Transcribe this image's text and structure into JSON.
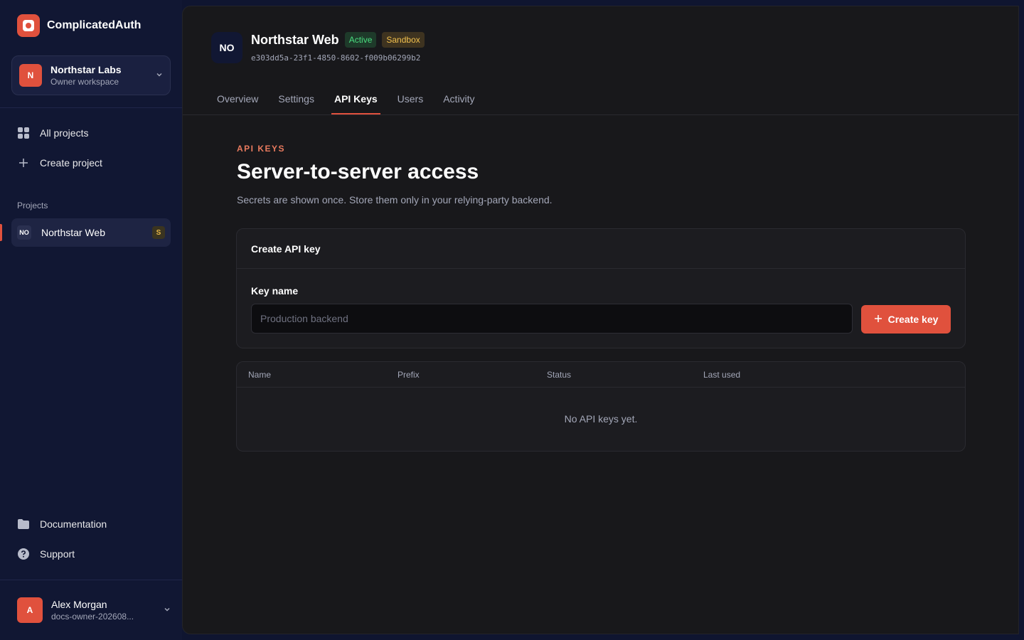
{
  "brand": {
    "name": "ComplicatedAuth"
  },
  "workspace": {
    "initial": "N",
    "name": "Northstar Labs",
    "role": "Owner workspace"
  },
  "nav": {
    "all_projects": "All projects",
    "create_project": "Create project",
    "projects_label": "Projects",
    "project": {
      "badge": "NO",
      "name": "Northstar Web",
      "env": "S"
    },
    "documentation": "Documentation",
    "support": "Support"
  },
  "user": {
    "initial": "A",
    "name": "Alex Morgan",
    "email": "docs-owner-202608..."
  },
  "header": {
    "avatar": "NO",
    "title": "Northstar Web",
    "status_badge": "Active",
    "env_badge": "Sandbox",
    "id": "e303dd5a-23f1-4850-8602-f009b06299b2"
  },
  "tabs": [
    "Overview",
    "Settings",
    "API Keys",
    "Users",
    "Activity"
  ],
  "page": {
    "eyebrow": "API KEYS",
    "heading": "Server-to-server access",
    "subtext": "Secrets are shown once. Store them only in your relying-party backend."
  },
  "create_card": {
    "title": "Create API key",
    "field_label": "Key name",
    "placeholder": "Production backend",
    "button": "Create key"
  },
  "keys_table": {
    "columns": [
      "Name",
      "Prefix",
      "Status",
      "Last used"
    ],
    "empty": "No API keys yet."
  },
  "colors": {
    "accent": "#e0513d",
    "active": "#4ade80",
    "sandbox": "#f2c14e"
  }
}
